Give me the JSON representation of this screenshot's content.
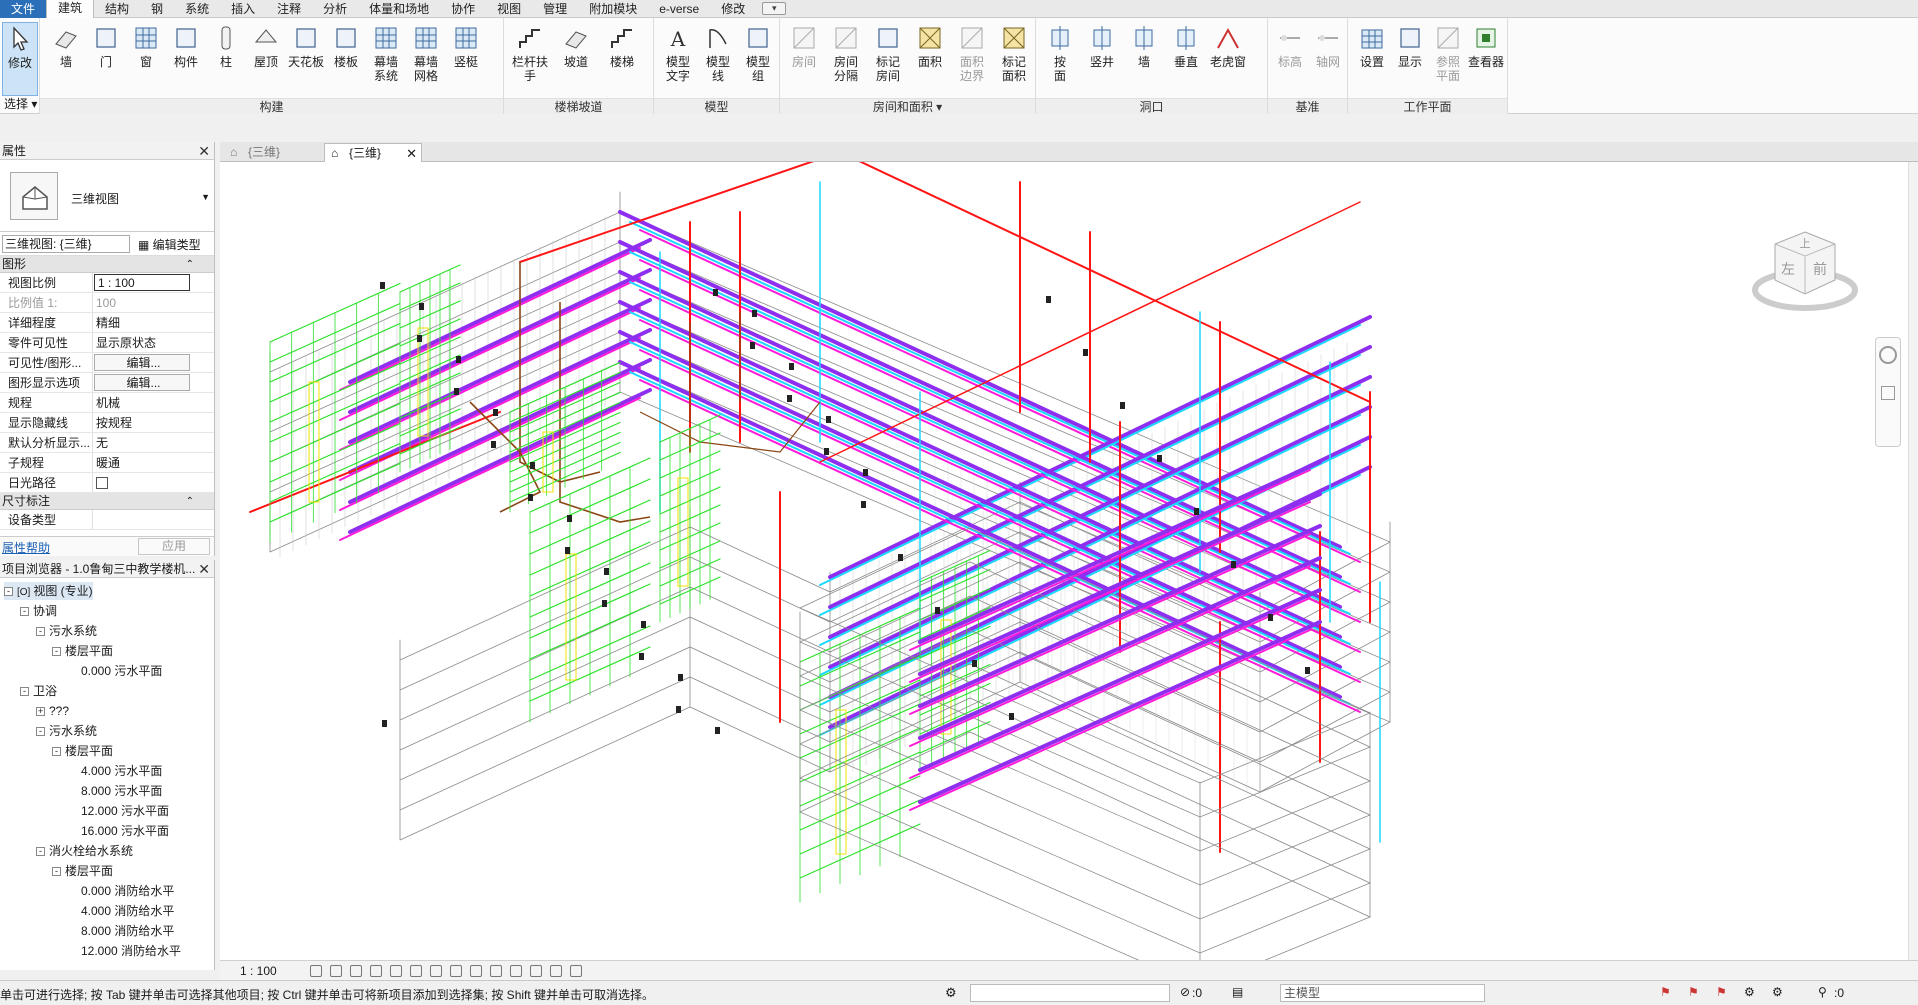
{
  "menu": {
    "tabs": [
      "文件",
      "建筑",
      "结构",
      "钢",
      "系统",
      "插入",
      "注释",
      "分析",
      "体量和场地",
      "协作",
      "视图",
      "管理",
      "附加模块",
      "e-verse",
      "修改"
    ],
    "active_index": 1,
    "extra": "▾"
  },
  "ribbon": {
    "select": {
      "modify": "修改",
      "dropdown": "选择 ▾"
    },
    "build": {
      "title": "构建",
      "buttons": [
        "墙",
        "门",
        "窗",
        "构件",
        "柱",
        "屋顶",
        "天花板",
        "楼板",
        "幕墙\n系统",
        "幕墙\n网格",
        "竖梃"
      ]
    },
    "stairs": {
      "title": "楼梯坡道",
      "buttons": [
        "栏杆扶手",
        "坡道",
        "楼梯"
      ]
    },
    "model": {
      "title": "模型",
      "buttons": [
        "模型\n文字",
        "模型\n线",
        "模型\n组"
      ]
    },
    "room": {
      "title": "房间和面积 ▾",
      "buttons": [
        "房间",
        "房间\n分隔",
        "标记\n房间",
        "面积",
        "面积\n边界",
        "标记\n面积"
      ]
    },
    "opening": {
      "title": "洞口",
      "buttons": [
        "按\n面",
        "竖井",
        "墙",
        "垂直",
        "老虎窗"
      ]
    },
    "datum": {
      "title": "基准",
      "buttons": [
        "标高",
        "轴网"
      ]
    },
    "workplane": {
      "title": "工作平面",
      "buttons": [
        "设置",
        "显示",
        "参照\n平面",
        "查看器"
      ]
    }
  },
  "properties": {
    "title": "属性",
    "type_name": "三维视图",
    "view_select": "三维视图: {三维}",
    "edit_type": "编辑类型",
    "group_graphics": "图形",
    "rows": [
      {
        "k": "视图比例",
        "v": "1 : 100"
      },
      {
        "k": "比例值 1:",
        "v": "100"
      },
      {
        "k": "详细程度",
        "v": "精细"
      },
      {
        "k": "零件可见性",
        "v": "显示原状态"
      },
      {
        "k": "可见性/图形...",
        "v": "编辑..."
      },
      {
        "k": "图形显示选项",
        "v": "编辑..."
      },
      {
        "k": "规程",
        "v": "机械"
      },
      {
        "k": "显示隐藏线",
        "v": "按规程"
      },
      {
        "k": "默认分析显示...",
        "v": "无"
      },
      {
        "k": "子规程",
        "v": "暖通"
      },
      {
        "k": "日光路径",
        "v": ""
      }
    ],
    "group_dims": "尺寸标注",
    "dims_row": "设备类型",
    "help": "属性帮助",
    "apply": "应用"
  },
  "browser": {
    "title": "项目浏览器 - 1.0鲁甸三中教学楼机...",
    "nodes": [
      {
        "label": "视图 (专业)",
        "level": 0,
        "box": "-",
        "icon": "[O]"
      },
      {
        "label": "协调",
        "level": 1,
        "box": "-"
      },
      {
        "label": "污水系统",
        "level": 2,
        "box": "-"
      },
      {
        "label": "楼层平面",
        "level": 3,
        "box": "-"
      },
      {
        "label": "0.000 污水平面",
        "level": 4
      },
      {
        "label": "卫浴",
        "level": 1,
        "box": "-"
      },
      {
        "label": "???",
        "level": 2,
        "box": "+"
      },
      {
        "label": "污水系统",
        "level": 2,
        "box": "-"
      },
      {
        "label": "楼层平面",
        "level": 3,
        "box": "-"
      },
      {
        "label": "4.000 污水平面",
        "level": 4
      },
      {
        "label": "8.000 污水平面",
        "level": 4
      },
      {
        "label": "12.000 污水平面",
        "level": 4
      },
      {
        "label": "16.000 污水平面",
        "level": 4
      },
      {
        "label": "消火栓给水系统",
        "level": 2,
        "box": "-"
      },
      {
        "label": "楼层平面",
        "level": 3,
        "box": "-"
      },
      {
        "label": "0.000 消防给水平",
        "level": 4
      },
      {
        "label": "4.000 消防给水平",
        "level": 4
      },
      {
        "label": "8.000 消防给水平",
        "level": 4
      },
      {
        "label": "12.000 消防给水平",
        "level": 4
      }
    ]
  },
  "viewtabs": [
    {
      "label": "{三维}",
      "active": false
    },
    {
      "label": "{三维}",
      "active": true,
      "close": "✕"
    }
  ],
  "viewcube": {
    "top": "上",
    "left": "左",
    "front": "前"
  },
  "viewbar": {
    "scale": "1 : 100"
  },
  "status": {
    "message": "单击可进行选择; 按 Tab 键并单击可选择其他项目; 按 Ctrl 键并单击可将新项目添加到选择集; 按 Shift 键并单击可取消选择。",
    "count1": ":0",
    "model": "主模型",
    "filter": ":0"
  },
  "colors": {
    "purple": "#8e2ff0",
    "magenta": "#ff1ad9",
    "red": "#ff1515",
    "cyan": "#1ad8ff",
    "green": "#2de12d",
    "brown": "#8b4513",
    "building": "#8a8a8a"
  }
}
